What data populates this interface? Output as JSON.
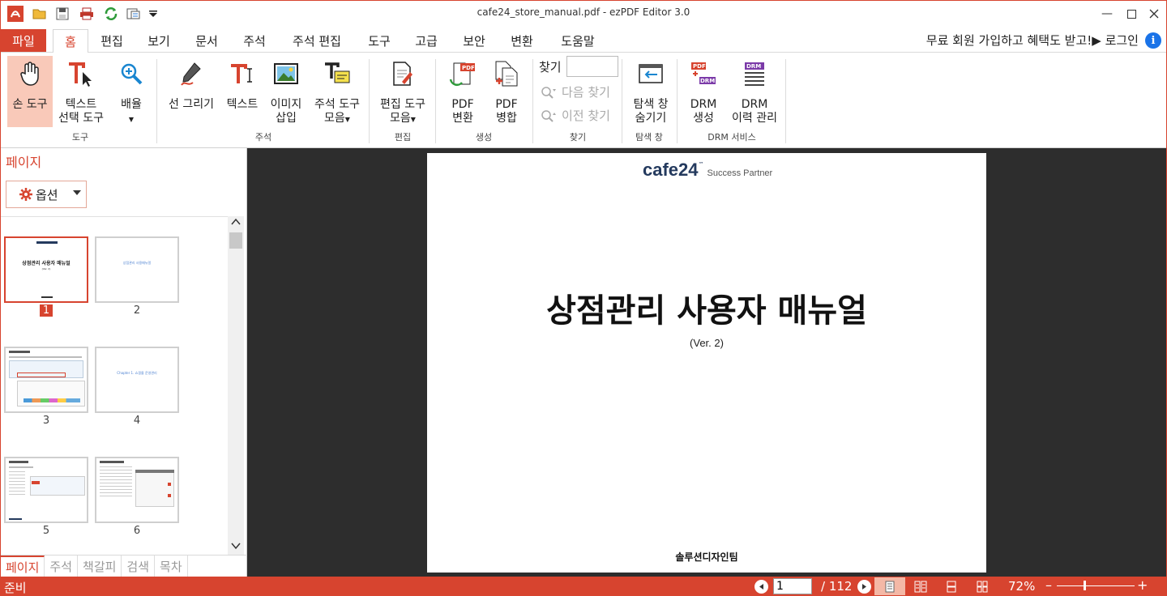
{
  "app": {
    "window_title": "cafe24_store_manual.pdf - ezPDF Editor 3.0"
  },
  "menu": {
    "file": "파일",
    "tabs": [
      "홈",
      "편집",
      "보기",
      "문서",
      "주석",
      "주석 편집",
      "도구",
      "고급",
      "보안",
      "변환",
      "도움말"
    ],
    "active_tab": "홈",
    "promo": "무료 회원 가입하고 혜택도 받고!▶ 로그인"
  },
  "ribbon": {
    "hand_tool": "손 도구",
    "text_select": "텍스트\n선택 도구",
    "zoom": "배율",
    "tools_group": "도구",
    "line_draw": "선 그리기",
    "text": "텍스트",
    "image_insert": "이미지\n삽입",
    "annot_tools": "주석 도구\n모음",
    "annot_group": "주석",
    "edit_tools": "편집 도구\n모음",
    "edit_group": "편집",
    "pdf_convert": "PDF\n변환",
    "pdf_merge": "PDF\n병합",
    "create_group": "생성",
    "find_label": "찾기",
    "find_value": "",
    "find_next": "다음 찾기",
    "find_prev": "이전 찾기",
    "find_group": "찾기",
    "nav_hide": "탐색 창\n숨기기",
    "nav_group": "탐색 창",
    "drm_create": "DRM\n생성",
    "drm_history": "DRM\n이력 관리",
    "drm_group": "DRM 서비스"
  },
  "panel": {
    "title": "페이지",
    "options": "옵션",
    "thumbnails": [
      "1",
      "2",
      "3",
      "4",
      "5",
      "6"
    ],
    "selected_page": "1",
    "thumb2_text": "상점관리 사용매뉴얼",
    "thumb4_text": "Chapter 1. 쇼핑몰 운영관리",
    "bottom_tabs": [
      "페이지",
      "주석",
      "책갈피",
      "검색",
      "목차"
    ]
  },
  "document": {
    "logo": "cafe24",
    "logo_tm": "™",
    "logo_sub": "Success Partner",
    "title": "상점관리 사용자 매뉴얼",
    "version": "(Ver. 2)",
    "footer": "솔루션디자인팀"
  },
  "status": {
    "text": "준비",
    "current_page": "1",
    "total_pages": "/ 112",
    "zoom": "72%"
  },
  "colors": {
    "accent": "#d7442f",
    "viewer_bg": "#2d2d2d",
    "logo": "#243a5e"
  }
}
